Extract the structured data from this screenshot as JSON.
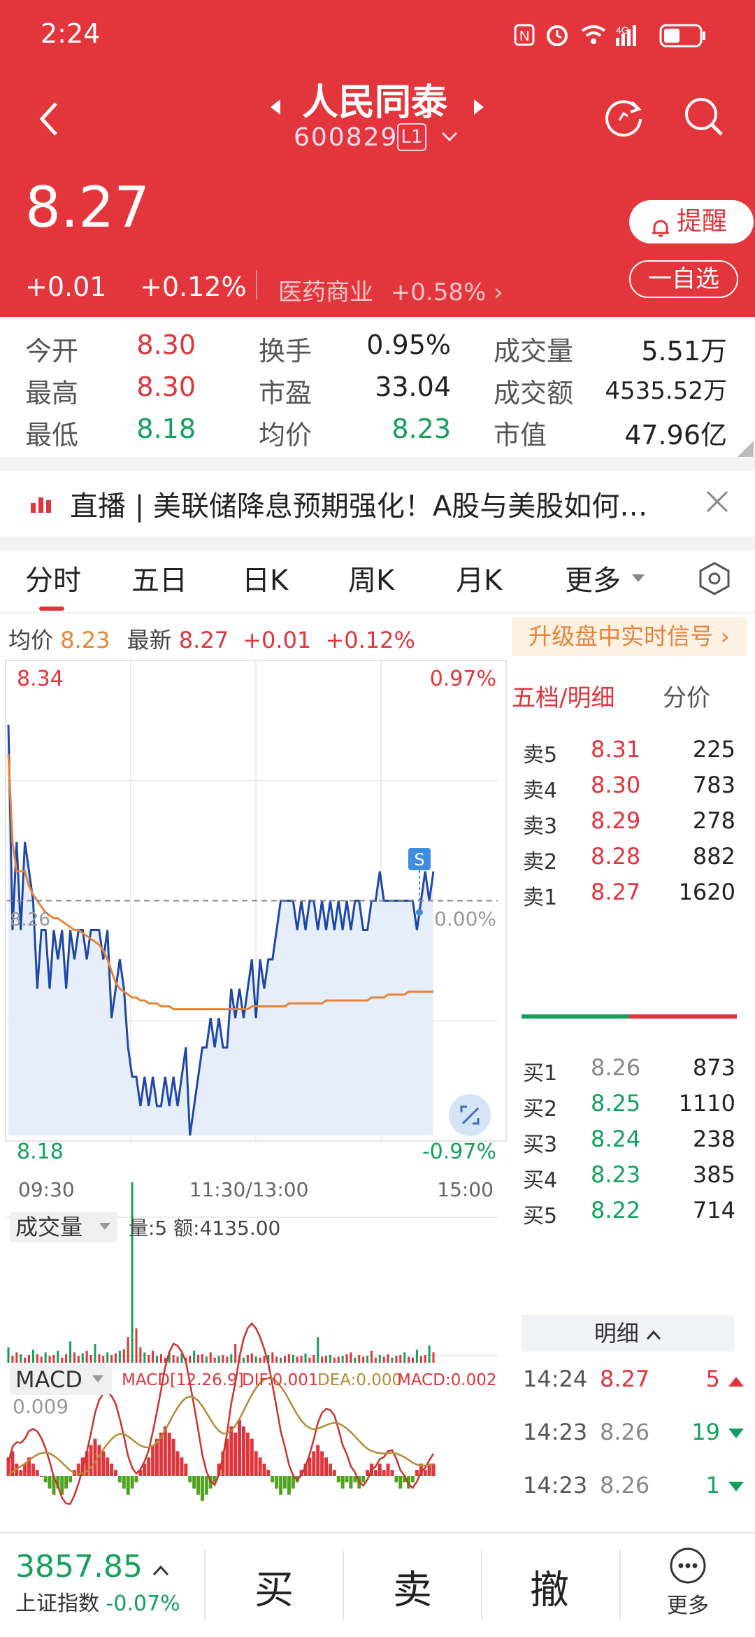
{
  "status_bar": {
    "time": "2:24"
  },
  "header": {
    "title": "人民同泰",
    "code": "600829",
    "level": "L1",
    "price": "8.27",
    "change": "+0.01",
    "change_pct": "+0.12%",
    "sector_name": "医药商业",
    "sector_change": "+0.58%",
    "alert_label": "提醒",
    "watch_label": "一自选"
  },
  "stats": [
    {
      "label": "今开",
      "value": "8.30",
      "color": "red"
    },
    {
      "label": "换手",
      "value": "0.95%",
      "color": "black"
    },
    {
      "label": "成交量",
      "value": "5.51万",
      "color": "black"
    },
    {
      "label": "最高",
      "value": "8.30",
      "color": "red"
    },
    {
      "label": "市盈",
      "value": "33.04",
      "color": "black"
    },
    {
      "label": "成交额",
      "value": "4535.52万",
      "color": "black"
    },
    {
      "label": "最低",
      "value": "8.18",
      "color": "green"
    },
    {
      "label": "均价",
      "value": "8.23",
      "color": "green"
    },
    {
      "label": "市值",
      "value": "47.96亿",
      "color": "black"
    }
  ],
  "news": {
    "text": "直播 | 美联储降息预期强化！A股与美股如何…"
  },
  "tabs": [
    "分时",
    "五日",
    "日K",
    "周K",
    "月K",
    "更多"
  ],
  "info_bar": {
    "avg_label": "均价",
    "avg_value": "8.23",
    "latest_label": "最新",
    "latest_value": "8.27",
    "change": "+0.01",
    "change_pct": "+0.12%",
    "upgrade": "升级盘中实时信号 ›"
  },
  "chart_labels": {
    "high": "8.34",
    "low": "8.18",
    "high_pct": "0.97%",
    "low_pct": "-0.97%",
    "zero_pct": "0.00%",
    "ref_price": "8.26",
    "time_start": "09:30",
    "time_mid": "11:30/13:00",
    "time_end": "15:00",
    "signal": "S"
  },
  "volume_panel": {
    "label": "成交量",
    "info": "量:5 额:4135.00"
  },
  "macd_panel": {
    "label": "MACD",
    "params": "MACD[12.26.9]",
    "dif": "DIF:0.001",
    "dea": "DEA:0.000",
    "macd": "MACD:0.002",
    "scale": "0.009"
  },
  "order_book": {
    "title_left": "五档/明细",
    "title_right": "分价",
    "asks": [
      {
        "label": "卖5",
        "price": "8.31",
        "vol": "225"
      },
      {
        "label": "卖4",
        "price": "8.30",
        "vol": "783"
      },
      {
        "label": "卖3",
        "price": "8.29",
        "vol": "278"
      },
      {
        "label": "卖2",
        "price": "8.28",
        "vol": "882"
      },
      {
        "label": "卖1",
        "price": "8.27",
        "vol": "1620"
      }
    ],
    "bids": [
      {
        "label": "买1",
        "price": "8.26",
        "vol": "873"
      },
      {
        "label": "买2",
        "price": "8.25",
        "vol": "1110"
      },
      {
        "label": "买3",
        "price": "8.24",
        "vol": "238"
      },
      {
        "label": "买4",
        "price": "8.23",
        "vol": "385"
      },
      {
        "label": "买5",
        "price": "8.22",
        "vol": "714"
      }
    ],
    "detail_label": "明细",
    "ticks": [
      {
        "time": "14:24",
        "price": "8.27",
        "vol": "5"
      },
      {
        "time": "14:23",
        "price": "8.26",
        "vol": "19"
      },
      {
        "time": "14:23",
        "price": "8.26",
        "vol": "1"
      }
    ]
  },
  "bottom": {
    "index_value": "3857.85",
    "index_name": "上证指数",
    "index_change": "-0.07%",
    "buy": "买",
    "sell": "卖",
    "cancel": "撤",
    "more": "更多"
  },
  "chart_data": {
    "type": "line",
    "xlabel": "",
    "ylabel": "",
    "x_ticks": [
      "09:30",
      "11:30/13:00",
      "15:00"
    ],
    "ylim": [
      8.18,
      8.34
    ],
    "reference_price": 8.26,
    "series": [
      {
        "values": [
          8.32,
          8.25,
          8.28,
          8.25,
          8.28,
          8.27,
          8.26,
          8.23,
          8.25,
          8.25,
          8.23,
          8.25,
          8.24,
          8.25,
          8.23,
          8.25,
          8.24,
          8.25,
          8.25,
          8.24,
          8.25,
          8.25,
          8.25,
          8.24,
          8.25,
          8.22,
          8.23,
          8.24,
          8.23,
          8.21,
          8.2,
          8.2,
          8.19,
          8.2,
          8.19,
          8.2,
          8.19,
          8.19,
          8.2,
          8.19,
          8.2,
          8.19,
          8.2,
          8.21,
          8.18,
          8.19,
          8.2,
          8.21,
          8.21,
          8.22,
          8.21,
          8.22,
          8.21,
          8.21,
          8.23,
          8.22,
          8.23,
          8.22,
          8.23,
          8.24,
          8.22,
          8.24,
          8.23,
          8.24,
          8.24,
          8.25,
          8.26,
          8.26,
          8.26,
          8.26,
          8.25,
          8.26,
          8.25,
          8.26,
          8.26,
          8.25,
          8.26,
          8.25,
          8.26,
          8.25,
          8.26,
          8.25,
          8.26,
          8.25,
          8.26,
          8.26,
          8.25,
          8.25,
          8.26,
          8.26,
          8.27,
          8.26,
          8.26,
          8.26,
          8.26,
          8.26,
          8.26,
          8.26,
          8.26,
          8.25,
          8.26,
          8.27,
          8.26,
          8.27
        ]
      },
      {
        "values": [
          8.31,
          8.28,
          8.27,
          8.27,
          8.27,
          8.265,
          8.262,
          8.26,
          8.258,
          8.256,
          8.255,
          8.254,
          8.254,
          8.253,
          8.252,
          8.251,
          8.25,
          8.25,
          8.249,
          8.248,
          8.247,
          8.246,
          8.245,
          8.243,
          8.24,
          8.236,
          8.232,
          8.23,
          8.229,
          8.228,
          8.227,
          8.227,
          8.226,
          8.226,
          8.225,
          8.225,
          8.225,
          8.224,
          8.224,
          8.224,
          8.223,
          8.223,
          8.223,
          8.223,
          8.223,
          8.223,
          8.223,
          8.223,
          8.223,
          8.223,
          8.223,
          8.223,
          8.223,
          8.223,
          8.223,
          8.223,
          8.223,
          8.223,
          8.223,
          8.224,
          8.224,
          8.224,
          8.224,
          8.224,
          8.224,
          8.224,
          8.224,
          8.224,
          8.225,
          8.225,
          8.225,
          8.225,
          8.225,
          8.225,
          8.225,
          8.225,
          8.225,
          8.226,
          8.226,
          8.226,
          8.226,
          8.226,
          8.226,
          8.226,
          8.226,
          8.226,
          8.226,
          8.226,
          8.227,
          8.227,
          8.227,
          8.227,
          8.228,
          8.228,
          8.228,
          8.228,
          8.228,
          8.229,
          8.229,
          8.229,
          8.229,
          8.229,
          8.229,
          8.229
        ]
      }
    ],
    "volume": [
      18,
      8,
      12,
      10,
      6,
      9,
      15,
      10,
      7,
      12,
      8,
      9,
      14,
      6,
      10,
      25,
      12,
      8,
      11,
      14,
      9,
      22,
      10,
      8,
      12,
      9,
      11,
      14,
      16,
      30,
      210,
      40,
      18,
      12,
      9,
      14,
      8,
      10,
      6,
      12,
      9,
      7,
      11,
      6,
      8,
      14,
      9,
      10,
      7,
      12,
      6,
      8,
      9,
      7,
      10,
      22,
      8,
      6,
      9,
      11,
      7,
      6,
      8,
      9,
      12,
      7,
      6,
      8,
      10,
      9,
      7,
      8,
      11,
      6,
      9,
      30,
      7,
      8,
      9,
      6,
      7,
      8,
      10,
      12,
      6,
      9,
      7,
      8,
      14,
      6,
      9,
      7,
      10,
      6,
      8,
      9,
      12,
      7,
      6,
      15,
      8,
      9,
      20,
      12
    ],
    "macd": [
      0.003,
      0.004,
      0.002,
      0.001,
      0.002,
      0.003,
      0.002,
      0.001,
      0.0,
      -0.001,
      -0.002,
      -0.003,
      -0.002,
      -0.003,
      -0.002,
      -0.001,
      0.001,
      0.002,
      0.003,
      0.004,
      0.005,
      0.006,
      0.005,
      0.004,
      0.003,
      0.002,
      0.001,
      -0.001,
      -0.002,
      -0.003,
      -0.002,
      -0.001,
      0.001,
      0.002,
      0.003,
      0.005,
      0.006,
      0.007,
      0.008,
      0.007,
      0.006,
      0.004,
      0.003,
      0.002,
      -0.001,
      -0.002,
      -0.003,
      -0.004,
      -0.003,
      -0.002,
      -0.001,
      0.002,
      0.004,
      0.006,
      0.008,
      0.007,
      0.009,
      0.008,
      0.007,
      0.006,
      0.004,
      0.003,
      0.002,
      0.001,
      -0.001,
      -0.002,
      -0.003,
      -0.002,
      -0.003,
      -0.002,
      -0.001,
      0.001,
      0.002,
      0.003,
      0.004,
      0.005,
      0.004,
      0.003,
      0.002,
      0.001,
      -0.001,
      -0.002,
      -0.001,
      -0.002,
      -0.001,
      -0.002,
      -0.001,
      0.001,
      0.002,
      0.001,
      0.002,
      0.001,
      0.002,
      0.001,
      -0.001,
      -0.002,
      -0.001,
      -0.002,
      -0.001,
      0.001,
      0.002,
      0.001,
      0.002,
      0.002
    ]
  }
}
